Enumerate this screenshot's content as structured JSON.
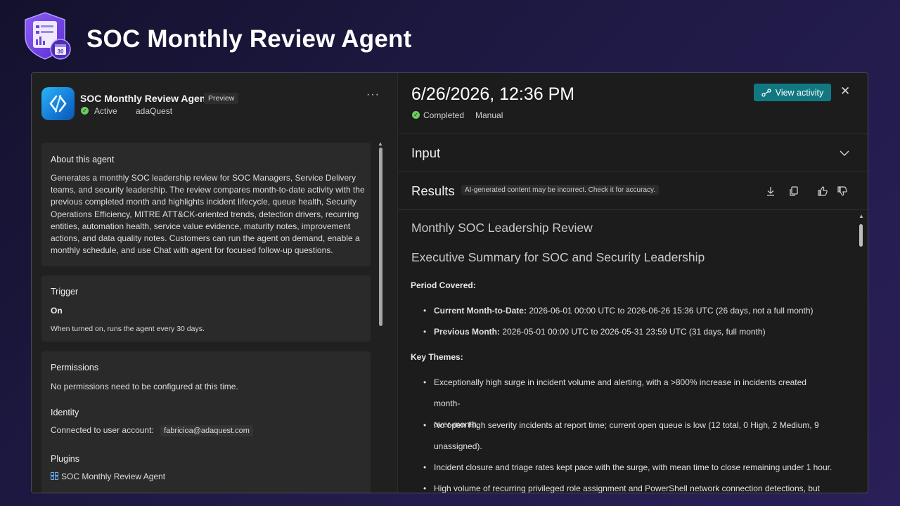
{
  "hero": {
    "title": "SOC Monthly Review Agent",
    "logo": "shield-calendar-icon"
  },
  "agent": {
    "name": "SOC Monthly Review Agent",
    "badge": "Preview",
    "status": "Active",
    "org": "adaQuest",
    "more": "···"
  },
  "about": {
    "title": "About this agent",
    "lines": [
      "Generates a monthly SOC leadership review for SOC Managers, Service Delivery",
      "teams, and security leadership. The review compares month-to-date activity with the",
      "previous completed month and highlights incident lifecycle, queue health, Security",
      "Operations Efficiency, MITRE ATT&CK-oriented trends, detection drivers, recurring",
      "entities, automation health, service value evidence, maturity notes, improvement",
      "actions, and data quality notes. Customers can run the agent on demand, enable a",
      "monthly schedule, and use Chat with agent for focused follow-up questions."
    ]
  },
  "trigger": {
    "title": "Trigger",
    "state": "On",
    "desc": "When turned on, runs the agent every 30 days."
  },
  "permissions": {
    "title": "Permissions",
    "desc": "No permissions need to be configured at this time."
  },
  "identity": {
    "title": "Identity",
    "label": "Connected to user account:",
    "email": "fabricioa@adaquest.com"
  },
  "plugins": {
    "title": "Plugins",
    "item": "SOC Monthly Review Agent"
  },
  "run": {
    "title": "6/26/2026, 12:36 PM",
    "status": "Completed",
    "mode": "Manual",
    "view_activity": "View activity",
    "close": "✕"
  },
  "input": {
    "title": "Input"
  },
  "results": {
    "title": "Results",
    "ai_note": "AI-generated content may be incorrect. Check it for accuracy."
  },
  "report": {
    "h1": "Monthly SOC Leadership Review",
    "h2": "Executive Summary for SOC and Security Leadership",
    "period_label": "Period Covered:",
    "current_label": "Current Month-to-Date:",
    "current_text": " 2026-06-01 00:00 UTC to 2026-06-26 15:36 UTC (26 days, not a full month)",
    "previous_label": "Previous Month:",
    "previous_text": " 2026-05-01 00:00 UTC to 2026-05-31 23:59 UTC (31 days, full month)",
    "themes_label": "Key Themes:",
    "themes": [
      [
        "Exceptionally high surge in incident volume and alerting, with a >800% increase in incidents created month-",
        "over-month."
      ],
      [
        "No open High severity incidents at report time; current open queue is low (12 total, 0 High, 2 Medium, 9",
        "unassigned)."
      ],
      [
        "Incident closure and triage rates kept pace with the surge, with mean time to close remaining under 1 hour."
      ],
      [
        "High volume of recurring privileged role assignment and PowerShell network connection detections, but most"
      ]
    ]
  }
}
